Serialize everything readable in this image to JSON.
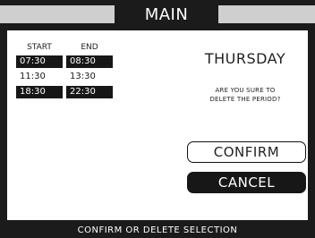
{
  "header": {
    "title": "MAIN"
  },
  "table": {
    "headers": {
      "start": "START",
      "end": "END"
    },
    "rows": [
      {
        "start": "07:30",
        "end": "08:30",
        "selected": true
      },
      {
        "start": "11:30",
        "end": "13:30",
        "selected": false
      },
      {
        "start": "18:30",
        "end": "22:30",
        "selected": true
      }
    ]
  },
  "dialog": {
    "day": "THURSDAY",
    "question_line1": "ARE YOU SURE TO",
    "question_line2": "DELETE THE PERIOD?",
    "confirm_label": "CONFIRM",
    "cancel_label": "CANCEL"
  },
  "footer": {
    "status": "CONFIRM OR DELETE SELECTION"
  },
  "colors": {
    "dark": "#1b1b1b",
    "light_gray": "#cfcfcf",
    "white": "#ffffff"
  }
}
